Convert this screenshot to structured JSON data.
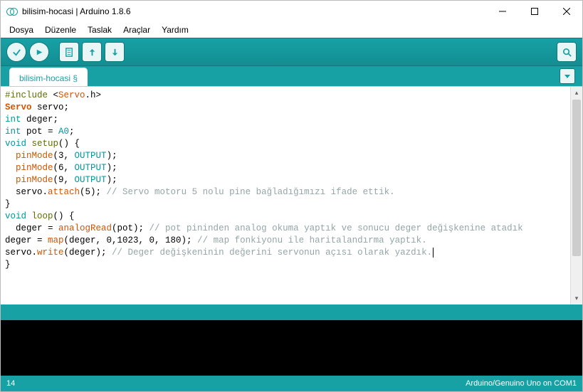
{
  "window": {
    "title": "bilisim-hocasi | Arduino 1.8.6"
  },
  "menu": {
    "file": "Dosya",
    "edit": "Düzenle",
    "sketch": "Taslak",
    "tools": "Araçlar",
    "help": "Yardım"
  },
  "tabs": {
    "active": "bilisim-hocasi §"
  },
  "status": {
    "line": "14",
    "board": "Arduino/Genuino Uno on COM1"
  },
  "code": {
    "l1_pp": "#include",
    "l1_b1": " <",
    "l1_inc": "Servo",
    "l1_b2": ".h>",
    "l2_type": "Servo",
    "l2_rest": " servo;",
    "l3_kw": "int",
    "l3_rest": " deger;",
    "l4_kw": "int",
    "l4_mid": " pot = ",
    "l4_lit": "A0",
    "l4_end": ";",
    "l5_kw": "void",
    "l5_sp": " ",
    "l5_fn": "setup",
    "l5_end": "() {",
    "l6_ind": "  ",
    "l6_fn": "pinMode",
    "l6_a": "(3, ",
    "l6_lit": "OUTPUT",
    "l6_end": ");",
    "l7_ind": "  ",
    "l7_fn": "pinMode",
    "l7_a": "(6, ",
    "l7_lit": "OUTPUT",
    "l7_end": ");",
    "l8_ind": "  ",
    "l8_fn": "pinMode",
    "l8_a": "(9, ",
    "l8_lit": "OUTPUT",
    "l8_end": ");",
    "l9_ind": "  servo.",
    "l9_fn": "attach",
    "l9_a": "(5); ",
    "l9_cmt": "// Servo motoru 5 nolu pine bağladığımızı ifade ettik.",
    "l10": "}",
    "l11_kw": "void",
    "l11_sp": " ",
    "l11_fn": "loop",
    "l11_end": "() {",
    "l12_ind": "  deger = ",
    "l12_fn": "analogRead",
    "l12_a": "(pot); ",
    "l12_cmt": "// pot pininden analog okuma yaptık ve sonucu deger değişkenine atadık",
    "l13_a": "deger = ",
    "l13_fn": "map",
    "l13_b": "(deger, 0,1023, 0, 180); ",
    "l13_cmt": "// map fonkiyonu ile haritalandırma yaptık.",
    "l14_a": "servo.",
    "l14_fn": "write",
    "l14_b": "(deger); ",
    "l14_cmt": "// Deger değişkeninin değerini servonun açısı olarak yazdık.",
    "l15": "}"
  }
}
